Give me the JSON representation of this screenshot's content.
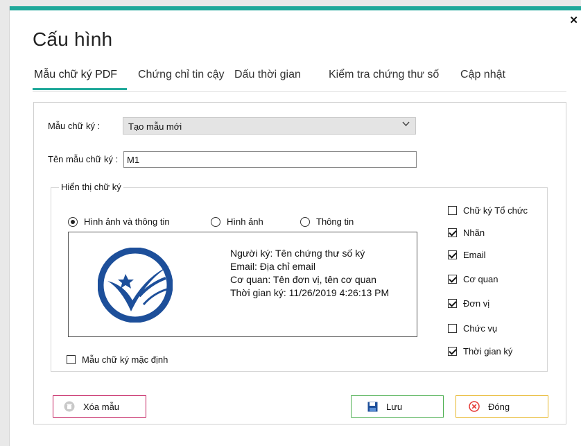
{
  "window": {
    "title": "Cấu hình",
    "close_glyph": "✕"
  },
  "tabs": [
    {
      "label": "Mẫu chữ ký PDF",
      "active": true
    },
    {
      "label": "Chứng chỉ tin cậy",
      "active": false
    },
    {
      "label": "Dấu thời gian",
      "active": false
    },
    {
      "label": "Kiểm tra chứng thư số",
      "active": false
    },
    {
      "label": "Cập nhật",
      "active": false
    }
  ],
  "form": {
    "template_label": "Mẫu chữ ký :",
    "template_value": "Tạo mẫu mới",
    "name_label": "Tên mẫu chữ ký :",
    "name_value": "M1"
  },
  "display": {
    "group_title": "Hiển thị chữ ký",
    "radios": [
      {
        "label": "Hình ảnh và thông tin",
        "selected": true
      },
      {
        "label": "Hình ảnh",
        "selected": false
      },
      {
        "label": "Thông tin",
        "selected": false
      }
    ],
    "preview": {
      "logo_icon": "ca-seal-logo",
      "lines": [
        "Người ký: Tên chứng thư số ký",
        "Email: Địa chỉ email",
        "Cơ quan: Tên đơn vị, tên cơ quan",
        "Thời gian ký: 11/26/2019 4:26:13 PM"
      ]
    },
    "default_template": {
      "label": "Mẫu chữ ký mặc định",
      "checked": false
    },
    "options": [
      {
        "label": "Chữ ký Tổ chức",
        "checked": false
      },
      {
        "label": "Nhãn",
        "checked": true
      },
      {
        "label": "Email",
        "checked": true
      },
      {
        "label": "Cơ quan",
        "checked": true
      },
      {
        "label": "Đơn vị",
        "checked": true
      },
      {
        "label": "Chức vụ",
        "checked": false
      },
      {
        "label": "Thời gian ký",
        "checked": true
      }
    ]
  },
  "buttons": {
    "delete": {
      "label": "Xóa mẫu",
      "icon": "trash-icon",
      "border": "#c2185b"
    },
    "save": {
      "label": "Lưu",
      "icon": "floppy-icon",
      "border": "#4caf50"
    },
    "close": {
      "label": "Đóng",
      "icon": "close-circle-icon",
      "border": "#e6b422"
    }
  },
  "colors": {
    "accent": "#1fa89a"
  }
}
